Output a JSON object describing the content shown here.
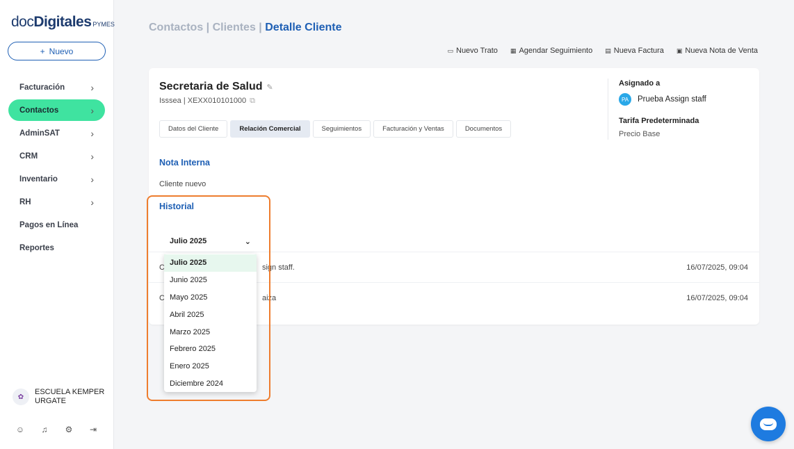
{
  "brand": {
    "doc": "doc",
    "digitales": "Digitales",
    "pymes": "PYMES"
  },
  "sidebar": {
    "new_label": "Nuevo",
    "new_icon": "+",
    "items": [
      {
        "label": "Facturación",
        "chevron": "›"
      },
      {
        "label": "Contactos",
        "chevron": "›",
        "active": true
      },
      {
        "label": "AdminSAT",
        "chevron": "›"
      },
      {
        "label": "CRM",
        "chevron": "›"
      },
      {
        "label": "Inventario",
        "chevron": "›"
      },
      {
        "label": "RH",
        "chevron": "›"
      },
      {
        "label": "Pagos en Línea"
      },
      {
        "label": "Reportes"
      }
    ],
    "company_line1": "ESCUELA KEMPER",
    "company_line2": "URGATE",
    "bottom_icons": [
      "user-circle-icon",
      "bell-icon",
      "gear-icon",
      "logout-icon"
    ]
  },
  "breadcrumb": {
    "part1": "Contactos",
    "sep": " | ",
    "part2": "Clientes",
    "current": "Detalle Cliente"
  },
  "actions": [
    {
      "icon": "briefcase-icon",
      "label": "Nuevo Trato"
    },
    {
      "icon": "calendar-icon",
      "label": "Agendar Seguimiento"
    },
    {
      "icon": "invoice-icon",
      "label": "Nueva Factura"
    },
    {
      "icon": "document-icon",
      "label": "Nueva Nota de Venta"
    }
  ],
  "client": {
    "name": "Secretaria de Salud",
    "subtitle": "Isssea | XEXX010101000"
  },
  "tabs": [
    {
      "label": "Datos del Cliente"
    },
    {
      "label": "Relación Comercial",
      "active": true
    },
    {
      "label": "Seguimientos"
    },
    {
      "label": "Facturación y Ventas"
    },
    {
      "label": "Documentos"
    }
  ],
  "assigned": {
    "label": "Asignado a",
    "initials": "PA",
    "person": "Prueba Assign staff",
    "tariff_label": "Tarifa Predeterminada",
    "tariff_value": "Precio Base"
  },
  "nota": {
    "title": "Nota Interna",
    "text": "Cliente nuevo"
  },
  "historial": {
    "title": "Historial",
    "selected": "Julio 2025",
    "options": [
      "Julio 2025",
      "Junio 2025",
      "Mayo 2025",
      "Abril 2025",
      "Marzo 2025",
      "Febrero 2025",
      "Enero 2025",
      "Diciembre 2024"
    ],
    "rows": [
      {
        "prefix": "C",
        "suffix": "sign staff.",
        "date": "16/07/2025, 09:04"
      },
      {
        "prefix": "C",
        "suffix": "aiza",
        "date": "16/07/2025, 09:04"
      }
    ]
  },
  "colors": {
    "accent": "#1e5fb4",
    "active_nav": "#3fe3a0",
    "highlight": "#ee7d2e",
    "chat": "#1e7be0"
  }
}
